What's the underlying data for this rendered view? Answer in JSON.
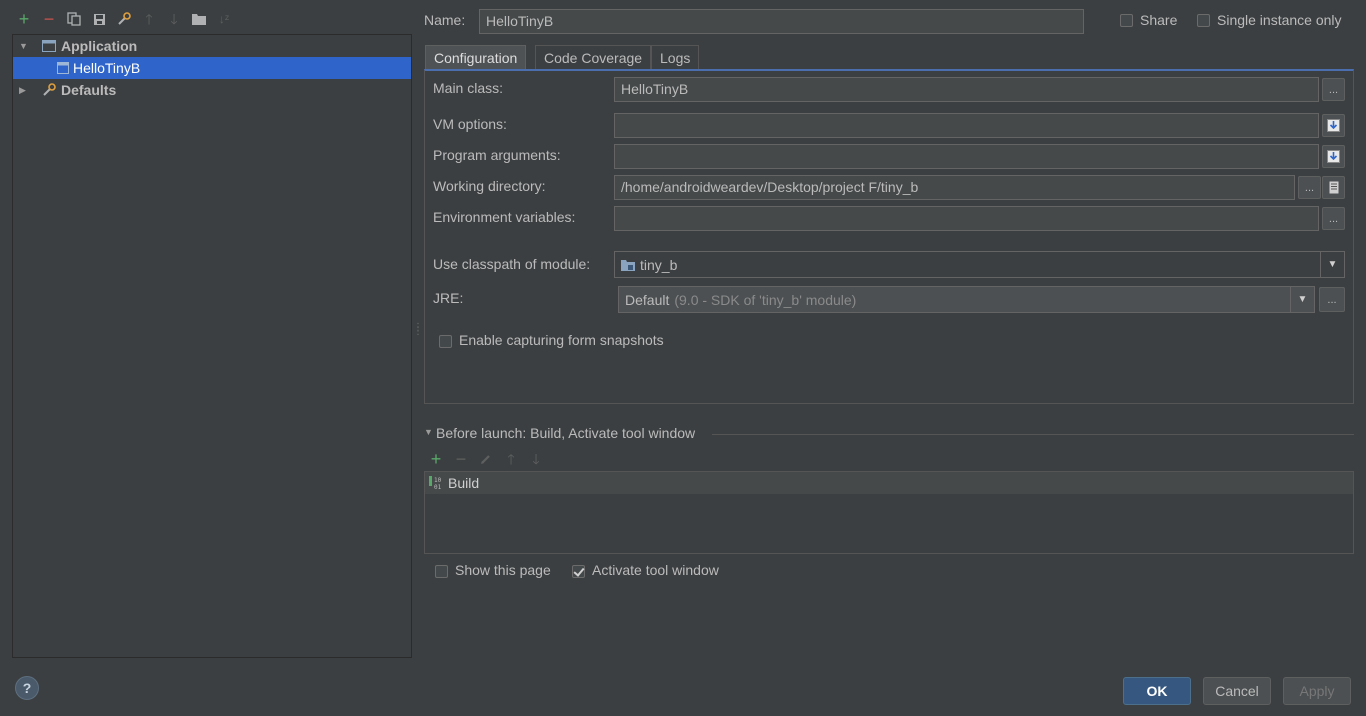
{
  "left_toolbar": {
    "icons": [
      "add-icon",
      "remove-icon",
      "copy-icon",
      "save-icon",
      "edit-defaults-icon",
      "move-up-icon",
      "move-down-icon",
      "folder-icon",
      "sort-icon"
    ]
  },
  "tree": {
    "items": [
      {
        "label": "Application",
        "icon": "application-icon"
      },
      {
        "label": "HelloTinyB",
        "icon": "run-config-icon"
      },
      {
        "label": "Defaults",
        "icon": "wrench-icon"
      }
    ]
  },
  "header": {
    "name_label": "Name:",
    "name_value": "HelloTinyB",
    "share_label": "Share",
    "single_instance_label": "Single instance only"
  },
  "tabs": [
    {
      "label": "Configuration"
    },
    {
      "label": "Code Coverage"
    },
    {
      "label": "Logs"
    }
  ],
  "config": {
    "main_class_label": "Main class:",
    "main_class_value": "HelloTinyB",
    "vm_options_label": "VM options:",
    "vm_options_value": "",
    "program_args_label": "Program arguments:",
    "program_args_value": "",
    "working_dir_label": "Working directory:",
    "working_dir_value": "/home/androidweardev/Desktop/project F/tiny_b",
    "env_vars_label": "Environment variables:",
    "env_vars_value": "",
    "classpath_label": "Use classpath of module:",
    "classpath_value": "tiny_b",
    "jre_label": "JRE:",
    "jre_value": "Default",
    "jre_detail": "(9.0 - SDK of 'tiny_b' module)",
    "snapshots_label": "Enable capturing form snapshots",
    "ellipsis": "..."
  },
  "before_launch": {
    "title": "Before launch: Build, Activate tool window",
    "items": [
      {
        "label": "Build"
      }
    ]
  },
  "bottom_options": {
    "show_page_label": "Show this page",
    "activate_label": "Activate tool window"
  },
  "buttons": {
    "help": "?",
    "ok": "OK",
    "cancel": "Cancel",
    "apply": "Apply"
  }
}
